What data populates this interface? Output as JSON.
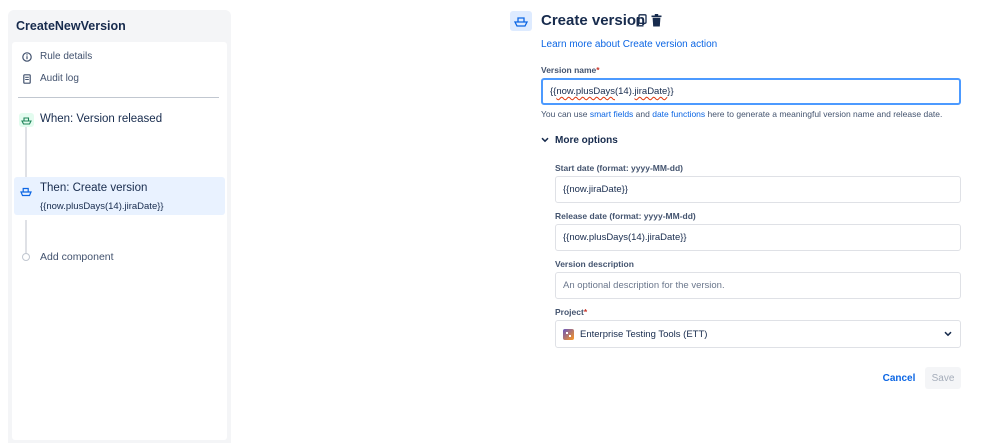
{
  "rule": {
    "title": "CreateNewVersion",
    "menu": {
      "rule_details": "Rule details",
      "audit_log": "Audit log"
    },
    "trigger": {
      "label": "When: Version released"
    },
    "action": {
      "label": "Then: Create version",
      "summary": "{{now.plusDays(14).jiraDate}}"
    },
    "add_component": "Add component"
  },
  "form": {
    "title": "Create version",
    "learn_more": "Learn more about Create version action",
    "version_name": {
      "label": "Version name",
      "required_mark": "*",
      "value_prefix": "{{",
      "value_word1": "now.plusDays",
      "value_mid": "(14).",
      "value_word2": "jiraDate",
      "value_suffix": "}}"
    },
    "helper": {
      "before": "You can use ",
      "link1": "smart fields",
      "middle": " and ",
      "link2": "date functions",
      "after": " here to generate a meaningful version name and release date."
    },
    "more_options": "More options",
    "start_date": {
      "label": "Start date (format: yyyy-MM-dd)",
      "value": "{{now.jiraDate}}"
    },
    "release_date": {
      "label": "Release date (format: yyyy-MM-dd)",
      "value": "{{now.plusDays(14).jiraDate}}"
    },
    "description": {
      "label": "Version description",
      "placeholder": "An optional description for the version."
    },
    "project": {
      "label": "Project",
      "required_mark": "*",
      "value": "Enterprise Testing Tools (ETT)"
    },
    "cancel": "Cancel",
    "save": "Save"
  },
  "colors": {
    "link": "#0c66e4",
    "focus_border": "#4c9aff",
    "selected_bg": "#e9f2ff",
    "required": "#c9372c"
  }
}
